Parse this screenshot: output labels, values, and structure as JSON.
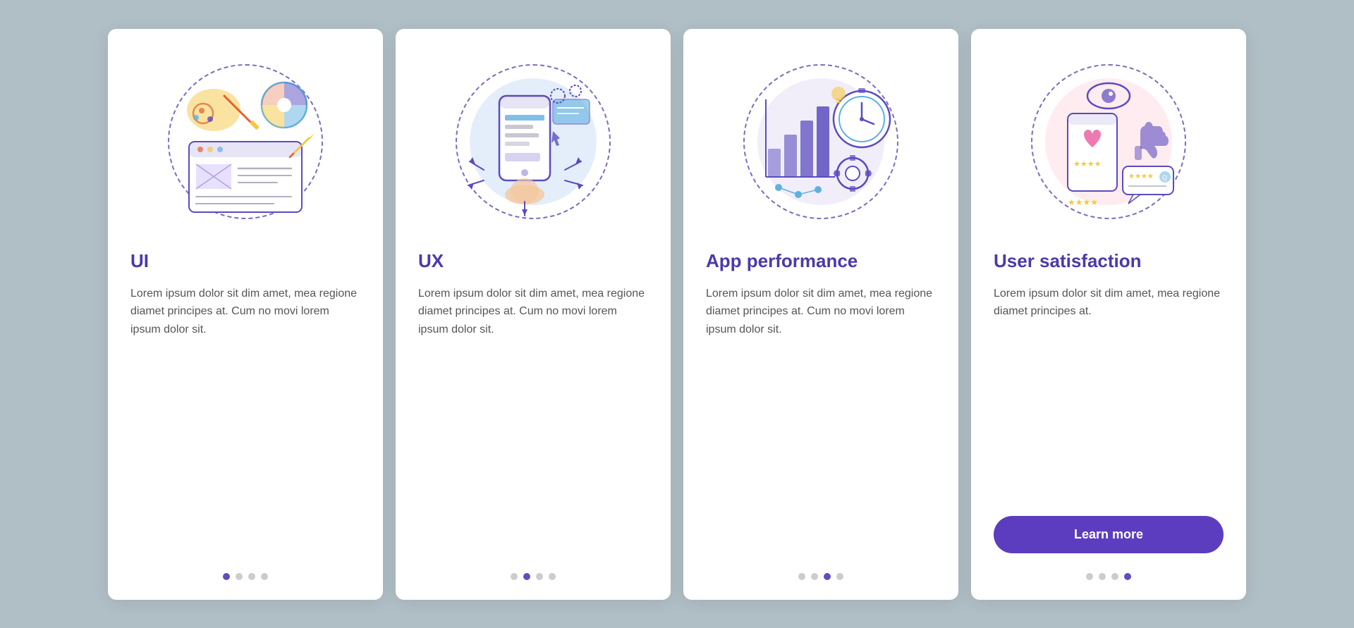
{
  "cards": [
    {
      "id": "ui",
      "title": "UI",
      "text": "Lorem ipsum dolor sit dim amet, mea regione diamet principes at. Cum no movi lorem ipsum dolor sit.",
      "dots": [
        true,
        false,
        false,
        false
      ],
      "button": null,
      "illustration": "ui"
    },
    {
      "id": "ux",
      "title": "UX",
      "text": "Lorem ipsum dolor sit dim amet, mea regione diamet principes at. Cum no movi lorem ipsum dolor sit.",
      "dots": [
        false,
        true,
        false,
        false
      ],
      "button": null,
      "illustration": "ux"
    },
    {
      "id": "app-performance",
      "title": "App performance",
      "text": "Lorem ipsum dolor sit dim amet, mea regione diamet principes at. Cum no movi lorem ipsum dolor sit.",
      "dots": [
        false,
        false,
        true,
        false
      ],
      "button": null,
      "illustration": "performance"
    },
    {
      "id": "user-satisfaction",
      "title": "User satisfaction",
      "text": "Lorem ipsum dolor sit dim amet, mea regione diamet principes at.",
      "dots": [
        false,
        false,
        false,
        true
      ],
      "button": "Learn more",
      "illustration": "satisfaction"
    }
  ],
  "colors": {
    "accent": "#5c3dbf",
    "title": "#4a3aaa",
    "text": "#555555",
    "dot_active": "#5c4fbf",
    "dot_inactive": "#cccccc",
    "button_bg": "#5c3dbf",
    "button_text": "#ffffff"
  }
}
